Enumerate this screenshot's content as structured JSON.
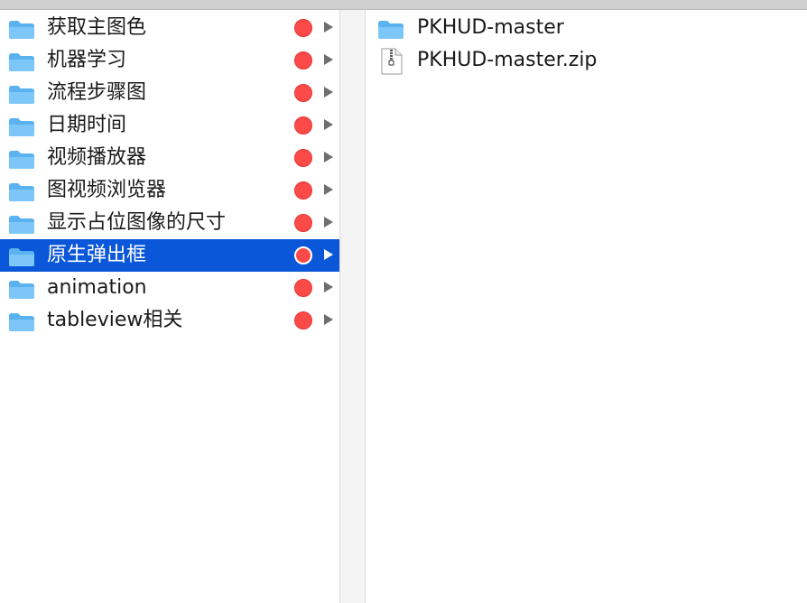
{
  "left_column": {
    "items": [
      {
        "label": "获取主图色",
        "tag_color": "#fc4a49",
        "icon": "folder-icon"
      },
      {
        "label": "机器学习",
        "tag_color": "#fc4a49",
        "icon": "folder-icon"
      },
      {
        "label": "流程步骤图",
        "tag_color": "#fc4a49",
        "icon": "folder-icon"
      },
      {
        "label": "日期时间",
        "tag_color": "#fc4a49",
        "icon": "folder-icon"
      },
      {
        "label": "视频播放器",
        "tag_color": "#fc4a49",
        "icon": "folder-icon"
      },
      {
        "label": "图视频浏览器",
        "tag_color": "#fc4a49",
        "icon": "folder-icon"
      },
      {
        "label": "显示占位图像的尺寸",
        "tag_color": "#fc4a49",
        "icon": "folder-icon"
      },
      {
        "label": "原生弹出框",
        "tag_color": "#fc4a49",
        "icon": "folder-icon",
        "selected": true
      },
      {
        "label": "animation",
        "tag_color": "#fc4a49",
        "icon": "folder-icon"
      },
      {
        "label": "tableview相关",
        "tag_color": "#fc4a49",
        "icon": "folder-icon"
      }
    ]
  },
  "right_column": {
    "items": [
      {
        "label": "PKHUD-master",
        "icon": "folder-icon"
      },
      {
        "label": "PKHUD-master.zip",
        "icon": "zip-file-icon"
      }
    ]
  },
  "colors": {
    "selection": "#0a57d9",
    "folder_blue": "#5ab3f0",
    "tag_red": "#fc4a49"
  }
}
